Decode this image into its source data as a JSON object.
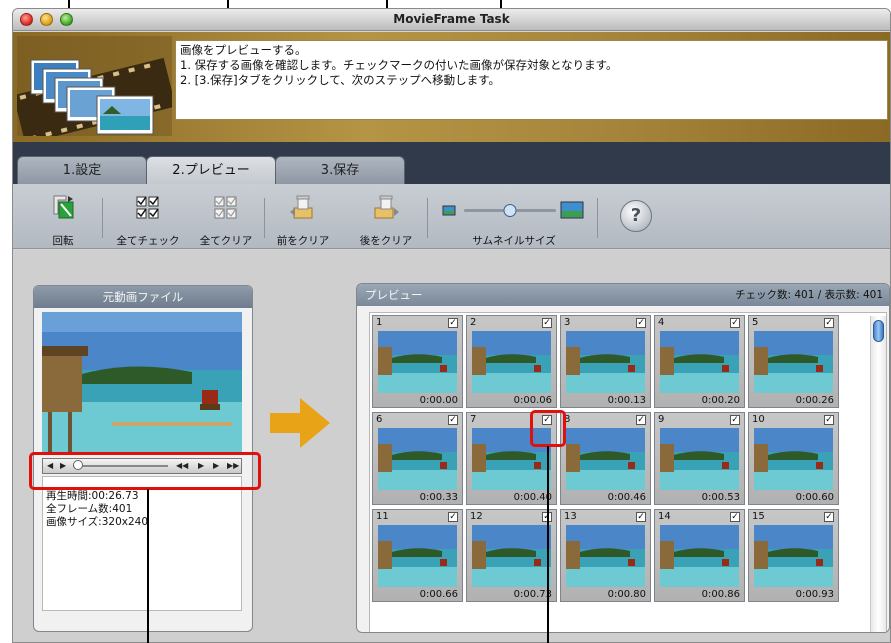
{
  "window": {
    "title": "MovieFrame Task"
  },
  "header": {
    "instructions": [
      "画像をプレビューする。",
      "1. 保存する画像を確認します。チェックマークの付いた画像が保存対象となります。",
      "2. [3.保存]タブをクリックして、次のステップへ移動します。"
    ]
  },
  "tabs": [
    {
      "label": "1.設定",
      "active": false
    },
    {
      "label": "2.プレビュー",
      "active": true
    },
    {
      "label": "3.保存",
      "active": false
    }
  ],
  "toolbar": {
    "rotate_label": "回転",
    "check_all_label": "全てチェック",
    "clear_all_label": "全てクリア",
    "clear_before_label": "前をクリア",
    "clear_after_label": "後をクリア",
    "thumb_size_label": "サムネイルサイズ",
    "help_glyph": "?",
    "thumb_size_value": 0.5
  },
  "source_panel": {
    "title": "元動画ファイル",
    "info": [
      "再生時間:00:26.73",
      "全フレーム数:401",
      "画像サイズ:320x240"
    ]
  },
  "preview_panel": {
    "title": "プレビュー",
    "stats": "チェック数: 401 / 表示数: 401",
    "frames": [
      {
        "num": "1",
        "time": "0:00.00",
        "checked": true
      },
      {
        "num": "2",
        "time": "0:00.06",
        "checked": true
      },
      {
        "num": "3",
        "time": "0:00.13",
        "checked": true
      },
      {
        "num": "4",
        "time": "0:00.20",
        "checked": true
      },
      {
        "num": "5",
        "time": "0:00.26",
        "checked": true
      },
      {
        "num": "6",
        "time": "0:00.33",
        "checked": true
      },
      {
        "num": "7",
        "time": "0:00.40",
        "checked": true
      },
      {
        "num": "8",
        "time": "0:00.46",
        "checked": true
      },
      {
        "num": "9",
        "time": "0:00.53",
        "checked": true
      },
      {
        "num": "10",
        "time": "0:00.60",
        "checked": true
      },
      {
        "num": "11",
        "time": "0:00.66",
        "checked": true
      },
      {
        "num": "12",
        "time": "0:00.73",
        "checked": true
      },
      {
        "num": "13",
        "time": "0:00.80",
        "checked": true
      },
      {
        "num": "14",
        "time": "0:00.86",
        "checked": true
      },
      {
        "num": "15",
        "time": "0:00.93",
        "checked": true
      }
    ]
  },
  "colors": {
    "accent_red": "#e0100d",
    "arrow_orange": "#e8a317",
    "banner_gold": "#b69445",
    "tab_bar": "#303a4a"
  },
  "icons": {
    "rotate": "rotate-icon",
    "check_all": "check-all-icon",
    "clear_all": "clear-all-icon",
    "clear_before": "clear-before-icon",
    "clear_after": "clear-after-icon",
    "help": "help-icon",
    "arrow": "right-arrow-icon"
  }
}
